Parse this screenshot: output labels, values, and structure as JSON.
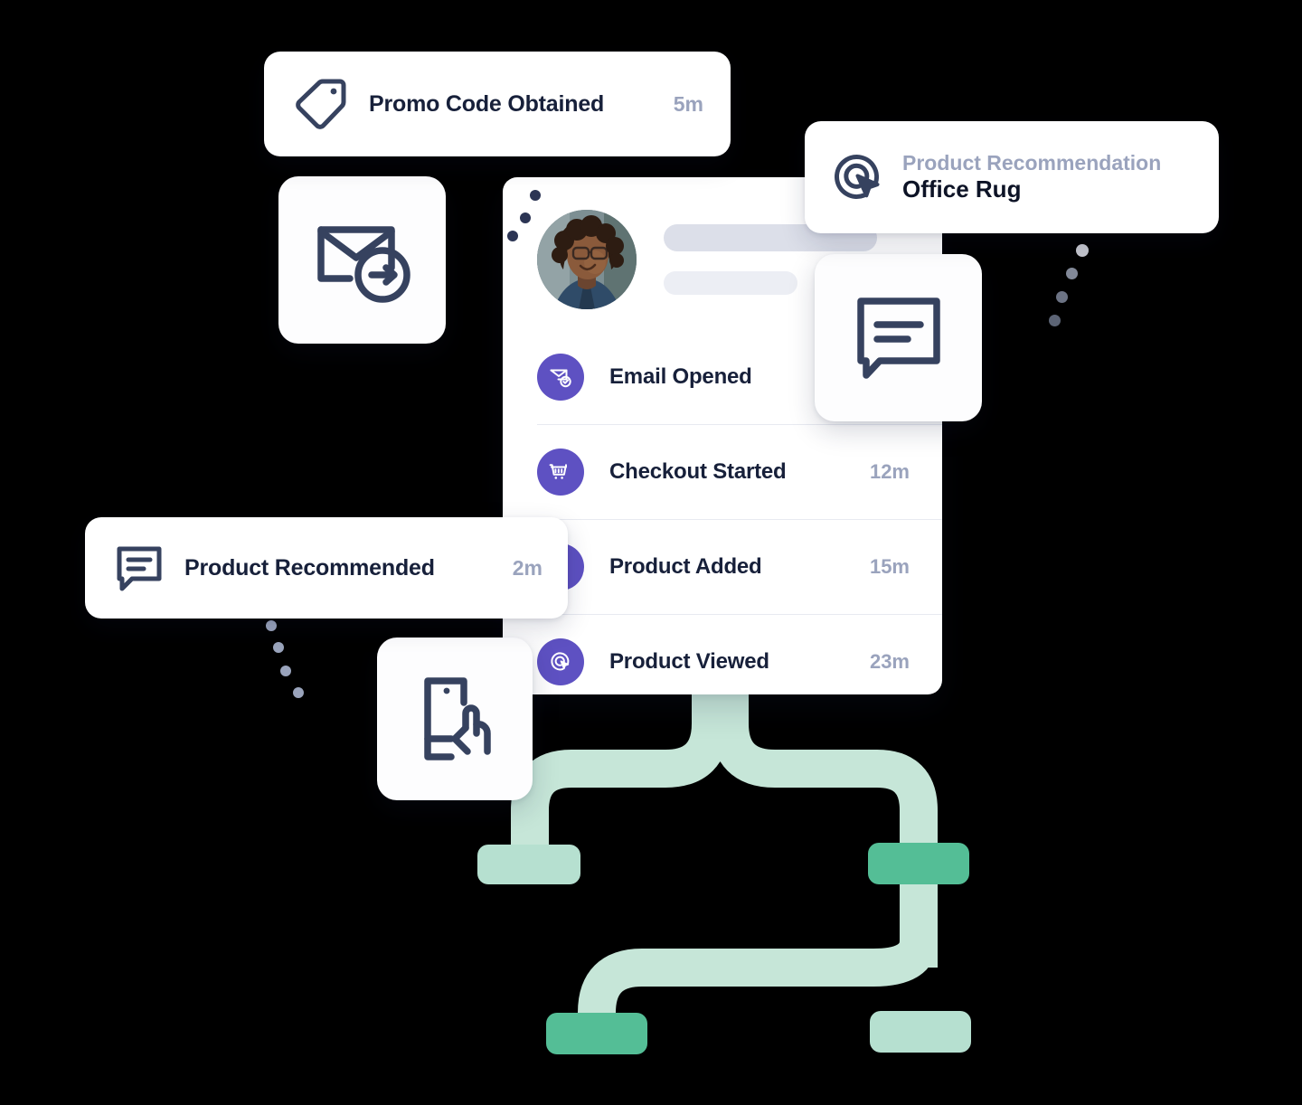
{
  "cards": {
    "promo": {
      "icon": "tag-icon",
      "title": "Promo Code Obtained",
      "time": "5m"
    },
    "recommendation": {
      "icon": "click-target-icon",
      "kicker": "Product Recommendation",
      "value": "Office Rug"
    },
    "product_recommended": {
      "icon": "chat-bubble-icon",
      "title": "Product Recommended",
      "time": "2m"
    }
  },
  "tiles": [
    {
      "name": "email-send-icon"
    },
    {
      "name": "chat-bubble-icon"
    },
    {
      "name": "mobile-tap-icon"
    }
  ],
  "timeline": {
    "avatar_alt": "user-avatar",
    "rows": [
      {
        "icon": "email-opened-icon",
        "label": "Email Opened",
        "time": ""
      },
      {
        "icon": "shopping-cart-icon",
        "label": "Checkout Started",
        "time": "12m"
      },
      {
        "icon": "shopping-cart-icon",
        "label": "Product Added",
        "time": "15m"
      },
      {
        "icon": "click-target-icon",
        "label": "Product Viewed",
        "time": "23m"
      }
    ]
  },
  "colors": {
    "accent_purple": "#5E51C2",
    "ink_navy": "#313F5B",
    "title_navy": "#17203A",
    "muted_gray": "#9AA3BD",
    "flow_mint_light": "#C6E6D8",
    "flow_mint_node": "#B6E0D0",
    "flow_green_node": "#54BE96",
    "card_white": "#FFFFFF",
    "background": "#000000"
  }
}
